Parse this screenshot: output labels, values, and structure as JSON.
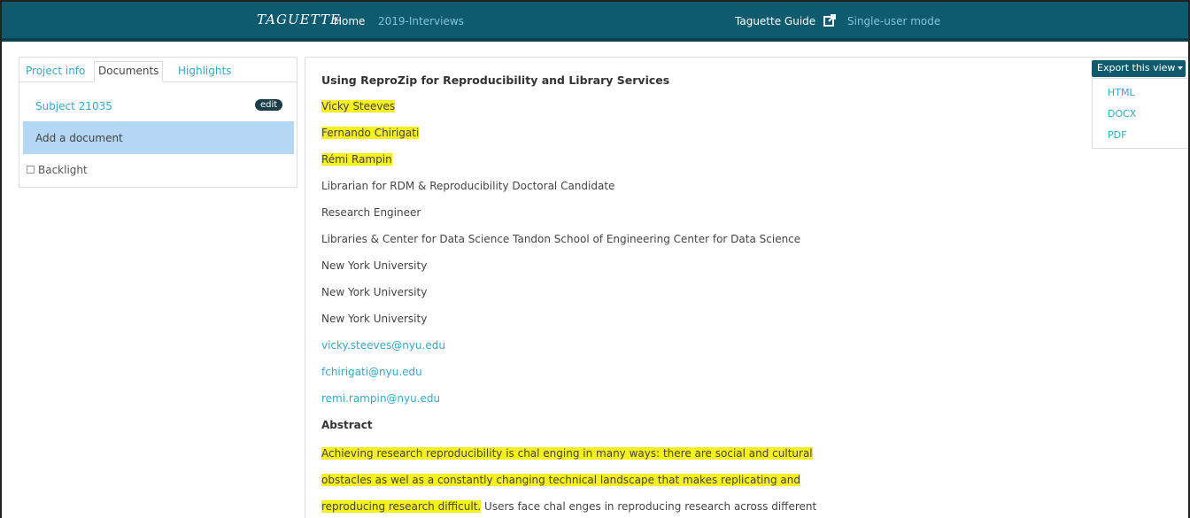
{
  "navbar": {
    "brand": "TAGUETTE",
    "home": "Home",
    "project": "2019-Interviews",
    "guide": "Taguette Guide",
    "mode": "Single-user mode"
  },
  "left_panel": {
    "tabs": [
      {
        "label": "Project info",
        "active": false
      },
      {
        "label": "Documents",
        "active": true
      },
      {
        "label": "Highlights",
        "active": false
      }
    ],
    "document": {
      "name": "Subject 21035",
      "edit_label": "edit"
    },
    "add_document": "Add a document",
    "backlight": "Backlight"
  },
  "export": {
    "button": "Export this view",
    "options": [
      "HTML",
      "DOCX",
      "PDF"
    ]
  },
  "document": {
    "title": "Using ReproZip for Reproducibility and Library Services",
    "lines": [
      {
        "text": "Vicky Steeves",
        "style": "highlight"
      },
      {
        "text": "Fernando Chirigati",
        "style": "highlight"
      },
      {
        "text": "Rémi Rampin",
        "style": "highlight"
      },
      {
        "text": "Librarian for RDM & Reproducibility Doctoral Candidate",
        "style": "plain"
      },
      {
        "text": "Research Engineer",
        "style": "plain"
      },
      {
        "text": "Libraries & Center for Data Science Tandon School of Engineering Center for Data Science",
        "style": "plain"
      },
      {
        "text": "New York University",
        "style": "plain"
      },
      {
        "text": "New York University",
        "style": "plain"
      },
      {
        "text": "New York University",
        "style": "plain"
      },
      {
        "text": "vicky.steeves@nyu.edu",
        "style": "link"
      },
      {
        "text": "fchirigati@nyu.edu",
        "style": "link"
      },
      {
        "text": "remi.rampin@nyu.edu",
        "style": "link"
      }
    ],
    "abstract_heading": "Abstract",
    "abstract": [
      {
        "highlight": "Achieving research reproducibility is chal enging in many ways: there are social and cultural",
        "rest": ""
      },
      {
        "highlight": "obstacles as wel  as a constantly changing technical landscape that makes replicating and",
        "rest": ""
      },
      {
        "highlight": "reproducing research difficult.",
        "rest": " Users face chal enges in reproducing research across different"
      }
    ]
  }
}
